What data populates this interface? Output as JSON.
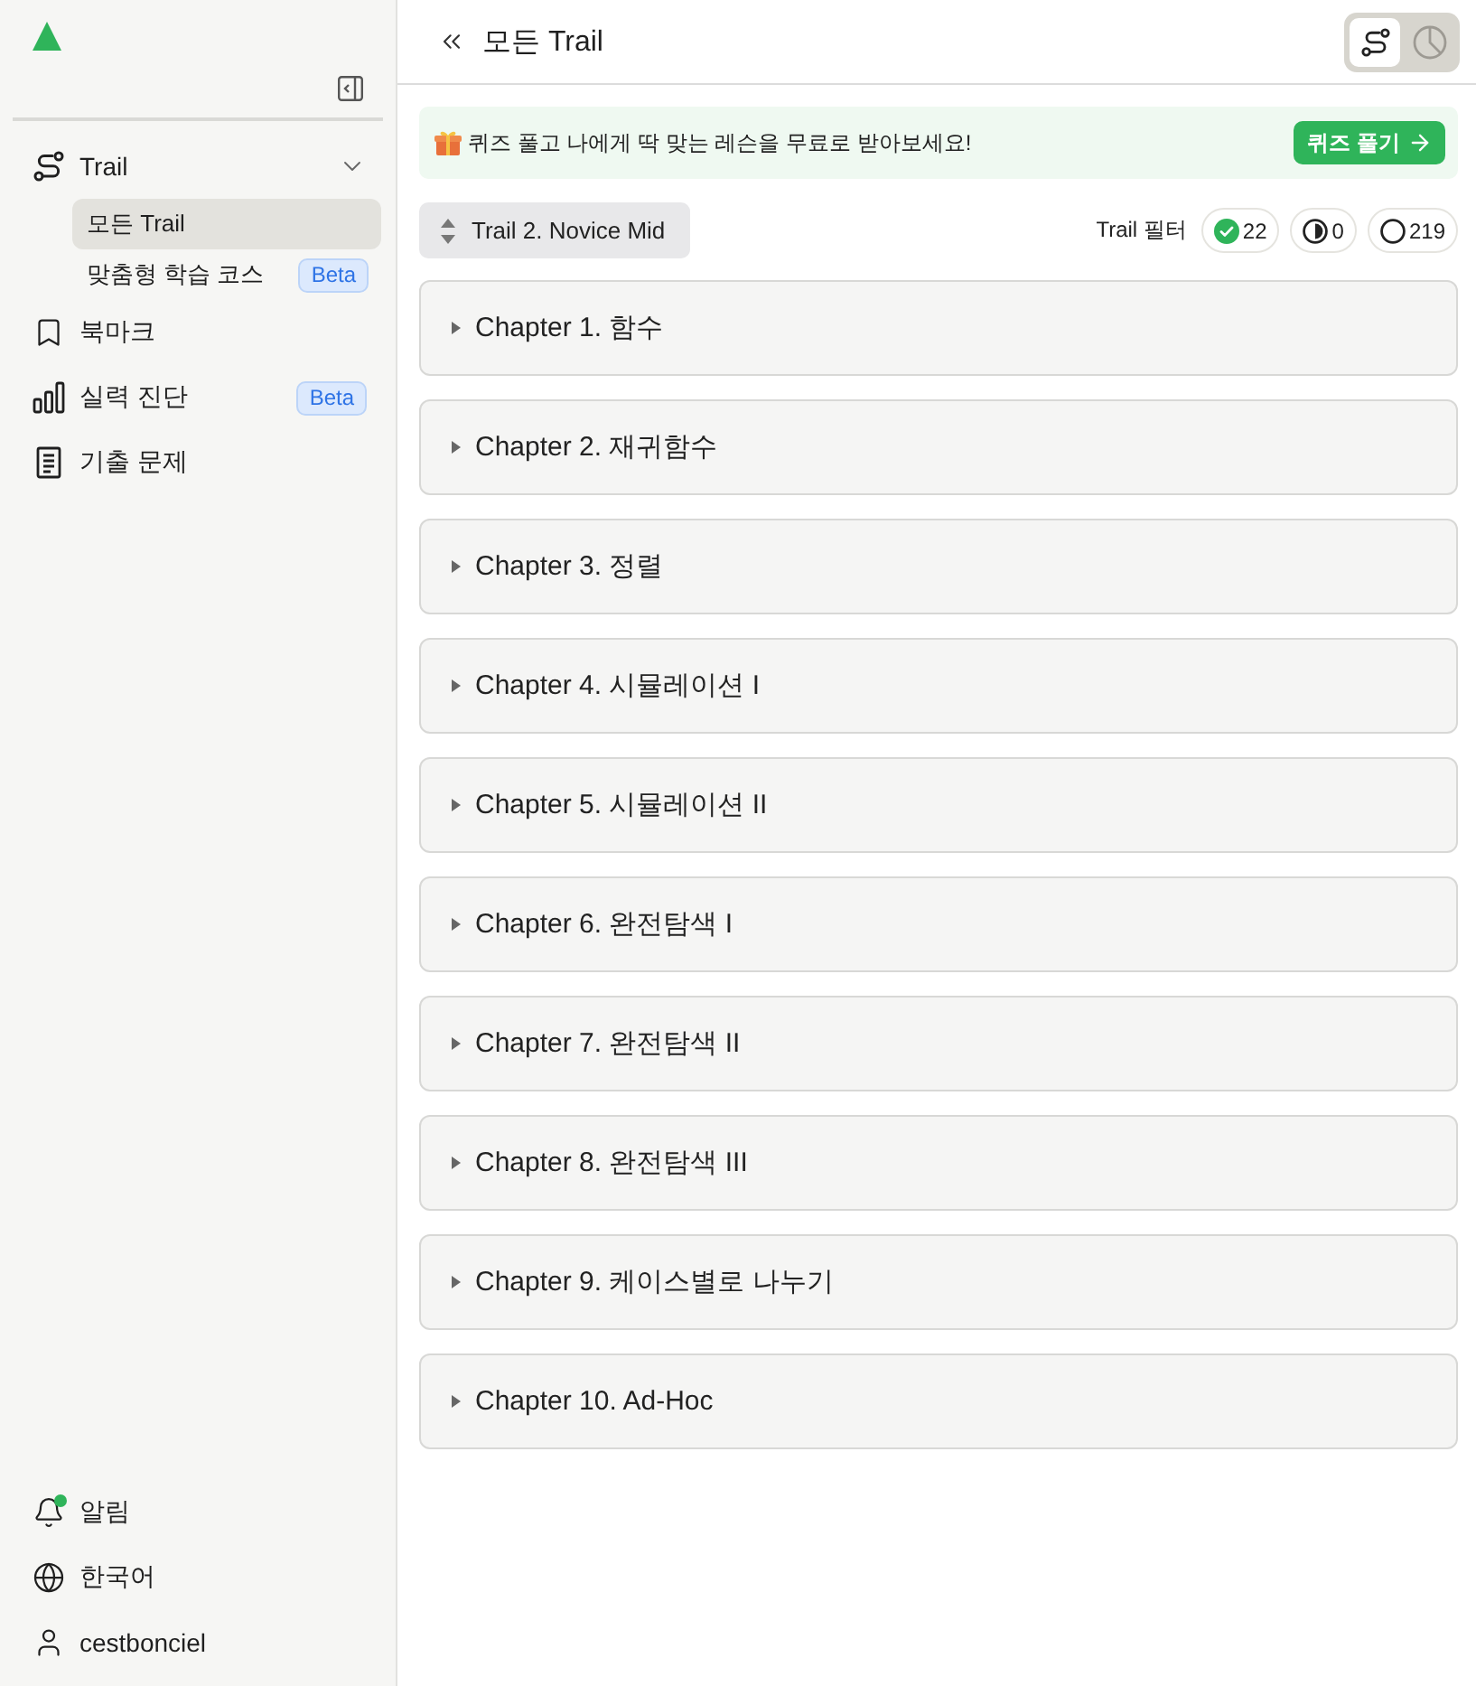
{
  "sidebar": {
    "nav": [
      {
        "kind": "trail",
        "label": "Trail",
        "expanded": true,
        "selected": false,
        "children": [
          {
            "label": "모든 Trail",
            "selected": true
          },
          {
            "label": "맞춤형 학습 코스",
            "selected": false,
            "badge": "Beta"
          }
        ]
      },
      {
        "kind": "bookmark",
        "label": "북마크",
        "selected": false
      },
      {
        "kind": "diagnosis",
        "label": "실력 진단",
        "selected": false,
        "badge": "Beta"
      },
      {
        "kind": "exam",
        "label": "기출 문제",
        "selected": false
      }
    ],
    "footer": [
      {
        "kind": "notification",
        "label": "알림",
        "unread": true
      },
      {
        "kind": "language",
        "label": "한국어"
      },
      {
        "kind": "account",
        "label": "cestbonciel"
      }
    ]
  },
  "header": {
    "title": "모든 Trail",
    "view_toggle": [
      {
        "kind": "trail",
        "selected": true
      },
      {
        "kind": "stats",
        "selected": false
      }
    ]
  },
  "banner": {
    "text": "퀴즈 풀고 나에게 딱 맞는 레슨을 무료로 받아보세요!",
    "button": "퀴즈 풀기"
  },
  "trail_selector": {
    "label": "Trail 2. Novice Mid"
  },
  "filter": {
    "label": "Trail 필터",
    "chips": [
      {
        "kind": "completed",
        "count": "22"
      },
      {
        "kind": "in_progress",
        "count": "0"
      },
      {
        "kind": "not_started",
        "count": "219"
      }
    ]
  },
  "chapters": [
    {
      "title": "Chapter 1. 함수",
      "expanded": false
    },
    {
      "title": "Chapter 2. 재귀함수",
      "expanded": false
    },
    {
      "title": "Chapter 3. 정렬",
      "expanded": false
    },
    {
      "title": "Chapter 4. 시뮬레이션 I",
      "expanded": false
    },
    {
      "title": "Chapter 5. 시뮬레이션 II",
      "expanded": false
    },
    {
      "title": "Chapter 6. 완전탐색 I",
      "expanded": false
    },
    {
      "title": "Chapter 7. 완전탐색 II",
      "expanded": false
    },
    {
      "title": "Chapter 8. 완전탐색 III",
      "expanded": false
    },
    {
      "title": "Chapter 9. 케이스별로 나누기",
      "expanded": false
    },
    {
      "title": "Chapter 10. Ad-Hoc",
      "expanded": false
    }
  ]
}
